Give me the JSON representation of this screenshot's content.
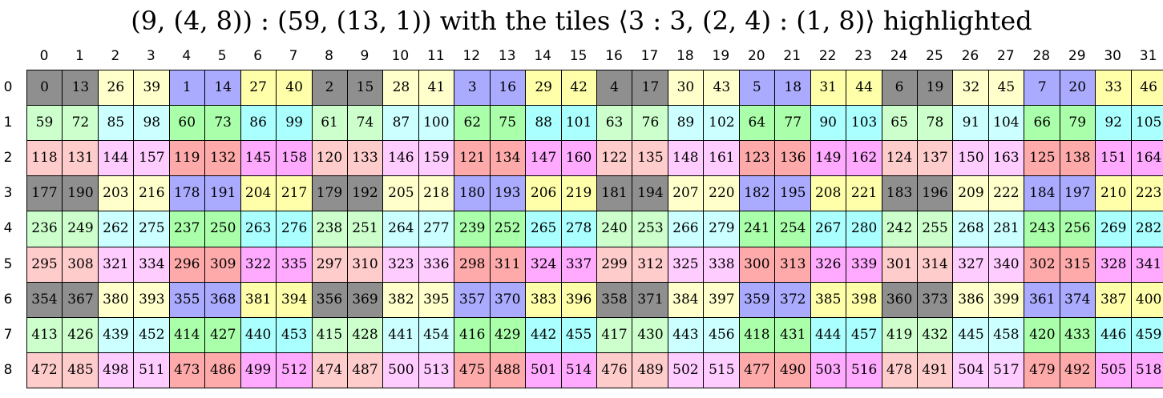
{
  "title": "(9, (4, 8)) : (59, (13, 1)) with the tiles ⟨3 : 3, (2, 4) : (1, 8)⟩ highlighted",
  "layout": {
    "shape": [
      9,
      32
    ],
    "stride": [
      59,
      1,
      13,
      2,
      4
    ]
  },
  "highlight_color": "#8f8f8f",
  "palette": [
    "#ccccff",
    "#ffffcc",
    "#ccffcc",
    "#ccffff",
    "#ffcccc",
    "#ffccff",
    "#aaaaff",
    "#ffffaa",
    "#aaffaa",
    "#aaffff",
    "#ffaaaa",
    "#ffaaff"
  ],
  "row_labels": [
    "0",
    "1",
    "2",
    "3",
    "4",
    "5",
    "6",
    "7",
    "8"
  ],
  "col_labels": [
    "0",
    "1",
    "2",
    "3",
    "4",
    "5",
    "6",
    "7",
    "8",
    "9",
    "10",
    "11",
    "12",
    "13",
    "14",
    "15",
    "16",
    "17",
    "18",
    "19",
    "20",
    "21",
    "22",
    "23",
    "24",
    "25",
    "26",
    "27",
    "28",
    "29",
    "30",
    "31"
  ],
  "cells": [
    [
      0,
      13,
      26,
      39,
      1,
      14,
      27,
      40,
      2,
      15,
      28,
      41,
      3,
      16,
      29,
      42,
      4,
      17,
      30,
      43,
      5,
      18,
      31,
      44,
      6,
      19,
      32,
      45,
      7,
      20,
      33,
      46
    ],
    [
      59,
      72,
      85,
      98,
      60,
      73,
      86,
      99,
      61,
      74,
      87,
      100,
      62,
      75,
      88,
      101,
      63,
      76,
      89,
      102,
      64,
      77,
      90,
      103,
      65,
      78,
      91,
      104,
      66,
      79,
      92,
      105
    ],
    [
      118,
      131,
      144,
      157,
      119,
      132,
      145,
      158,
      120,
      133,
      146,
      159,
      121,
      134,
      147,
      160,
      122,
      135,
      148,
      161,
      123,
      136,
      149,
      162,
      124,
      137,
      150,
      163,
      125,
      138,
      151,
      164
    ],
    [
      177,
      190,
      203,
      216,
      178,
      191,
      204,
      217,
      179,
      192,
      205,
      218,
      180,
      193,
      206,
      219,
      181,
      194,
      207,
      220,
      182,
      195,
      208,
      221,
      183,
      196,
      209,
      222,
      184,
      197,
      210,
      223
    ],
    [
      236,
      249,
      262,
      275,
      237,
      250,
      263,
      276,
      238,
      251,
      264,
      277,
      239,
      252,
      265,
      278,
      240,
      253,
      266,
      279,
      241,
      254,
      267,
      280,
      242,
      255,
      268,
      281,
      243,
      256,
      269,
      282
    ],
    [
      295,
      308,
      321,
      334,
      296,
      309,
      322,
      335,
      297,
      310,
      323,
      336,
      298,
      311,
      324,
      337,
      299,
      312,
      325,
      338,
      300,
      313,
      326,
      339,
      301,
      314,
      327,
      340,
      302,
      315,
      328,
      341
    ],
    [
      354,
      367,
      380,
      393,
      355,
      368,
      381,
      394,
      356,
      369,
      382,
      395,
      357,
      370,
      383,
      396,
      358,
      371,
      384,
      397,
      359,
      372,
      385,
      398,
      360,
      373,
      386,
      399,
      361,
      374,
      387,
      400
    ],
    [
      413,
      426,
      439,
      452,
      414,
      427,
      440,
      453,
      415,
      428,
      441,
      454,
      416,
      429,
      442,
      455,
      417,
      430,
      443,
      456,
      418,
      431,
      444,
      457,
      419,
      432,
      445,
      458,
      420,
      433,
      446,
      459
    ],
    [
      472,
      485,
      498,
      511,
      473,
      486,
      499,
      512,
      474,
      487,
      500,
      513,
      475,
      488,
      501,
      514,
      476,
      489,
      502,
      515,
      477,
      490,
      503,
      516,
      478,
      491,
      504,
      517,
      479,
      492,
      505,
      518
    ]
  ]
}
